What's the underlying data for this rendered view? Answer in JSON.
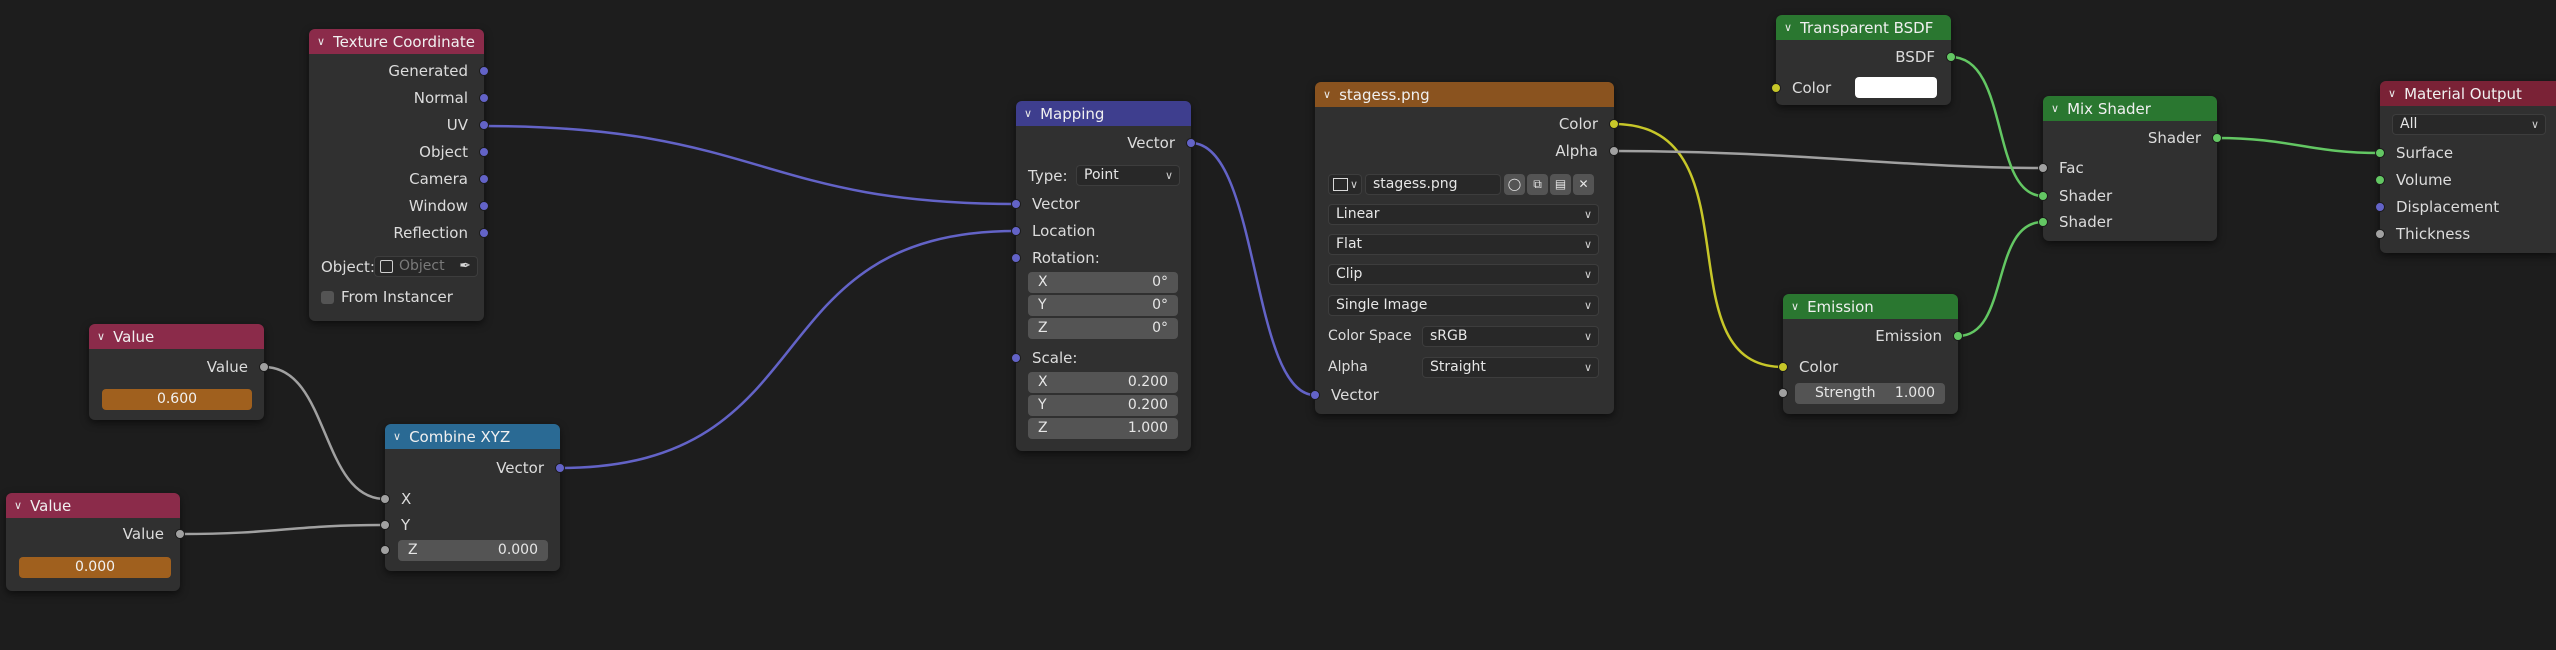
{
  "colors": {
    "background": "#1d1d1d",
    "header_input": "#8b2b4a",
    "header_converter": "#2a6a94",
    "header_vector": "#3e3e8e",
    "header_texture": "#8a531f",
    "header_shader": "#2a7730",
    "header_output": "#7a2236",
    "socket_vector": "#6363c7",
    "socket_color": "#c7c729",
    "socket_float": "#a1a1a1",
    "socket_shader": "#63c763"
  },
  "texcoord": {
    "title": "Texture Coordinate",
    "outputs": [
      "Generated",
      "Normal",
      "UV",
      "Object",
      "Camera",
      "Window",
      "Reflection"
    ],
    "object_label": "Object:",
    "object_placeholder": "Object",
    "from_instancer": "From Instancer"
  },
  "value1": {
    "title": "Value",
    "output": "Value",
    "value": "0.600"
  },
  "value2": {
    "title": "Value",
    "output": "Value",
    "value": "0.000"
  },
  "combine": {
    "title": "Combine XYZ",
    "output": "Vector",
    "x": "X",
    "y": "Y",
    "z_label": "Z",
    "z_value": "0.000"
  },
  "mapping": {
    "title": "Mapping",
    "output": "Vector",
    "type_label": "Type:",
    "type_value": "Point",
    "vector": "Vector",
    "location": "Location",
    "rotation": "Rotation:",
    "rot": [
      {
        "k": "X",
        "v": "0°"
      },
      {
        "k": "Y",
        "v": "0°"
      },
      {
        "k": "Z",
        "v": "0°"
      }
    ],
    "scale_label": "Scale:",
    "scale": [
      {
        "k": "X",
        "v": "0.200"
      },
      {
        "k": "Y",
        "v": "0.200"
      },
      {
        "k": "Z",
        "v": "1.000"
      }
    ]
  },
  "image": {
    "title": "stagess.png",
    "out_color": "Color",
    "out_alpha": "Alpha",
    "filename": "stagess.png",
    "interpolation": "Linear",
    "projection": "Flat",
    "extension": "Clip",
    "source": "Single Image",
    "colorspace_label": "Color Space",
    "colorspace": "sRGB",
    "alpha_label": "Alpha",
    "alpha_mode": "Straight",
    "in_vector": "Vector"
  },
  "transparent": {
    "title": "Transparent BSDF",
    "output": "BSDF",
    "color": "Color",
    "swatch": "#ffffff"
  },
  "emission": {
    "title": "Emission",
    "output": "Emission",
    "color": "Color",
    "strength_label": "Strength",
    "strength_value": "1.000"
  },
  "mix": {
    "title": "Mix Shader",
    "output": "Shader",
    "fac": "Fac",
    "shader1": "Shader",
    "shader2": "Shader"
  },
  "output": {
    "title": "Material Output",
    "target": "All",
    "surface": "Surface",
    "volume": "Volume",
    "displacement": "Displacement",
    "thickness": "Thickness"
  }
}
